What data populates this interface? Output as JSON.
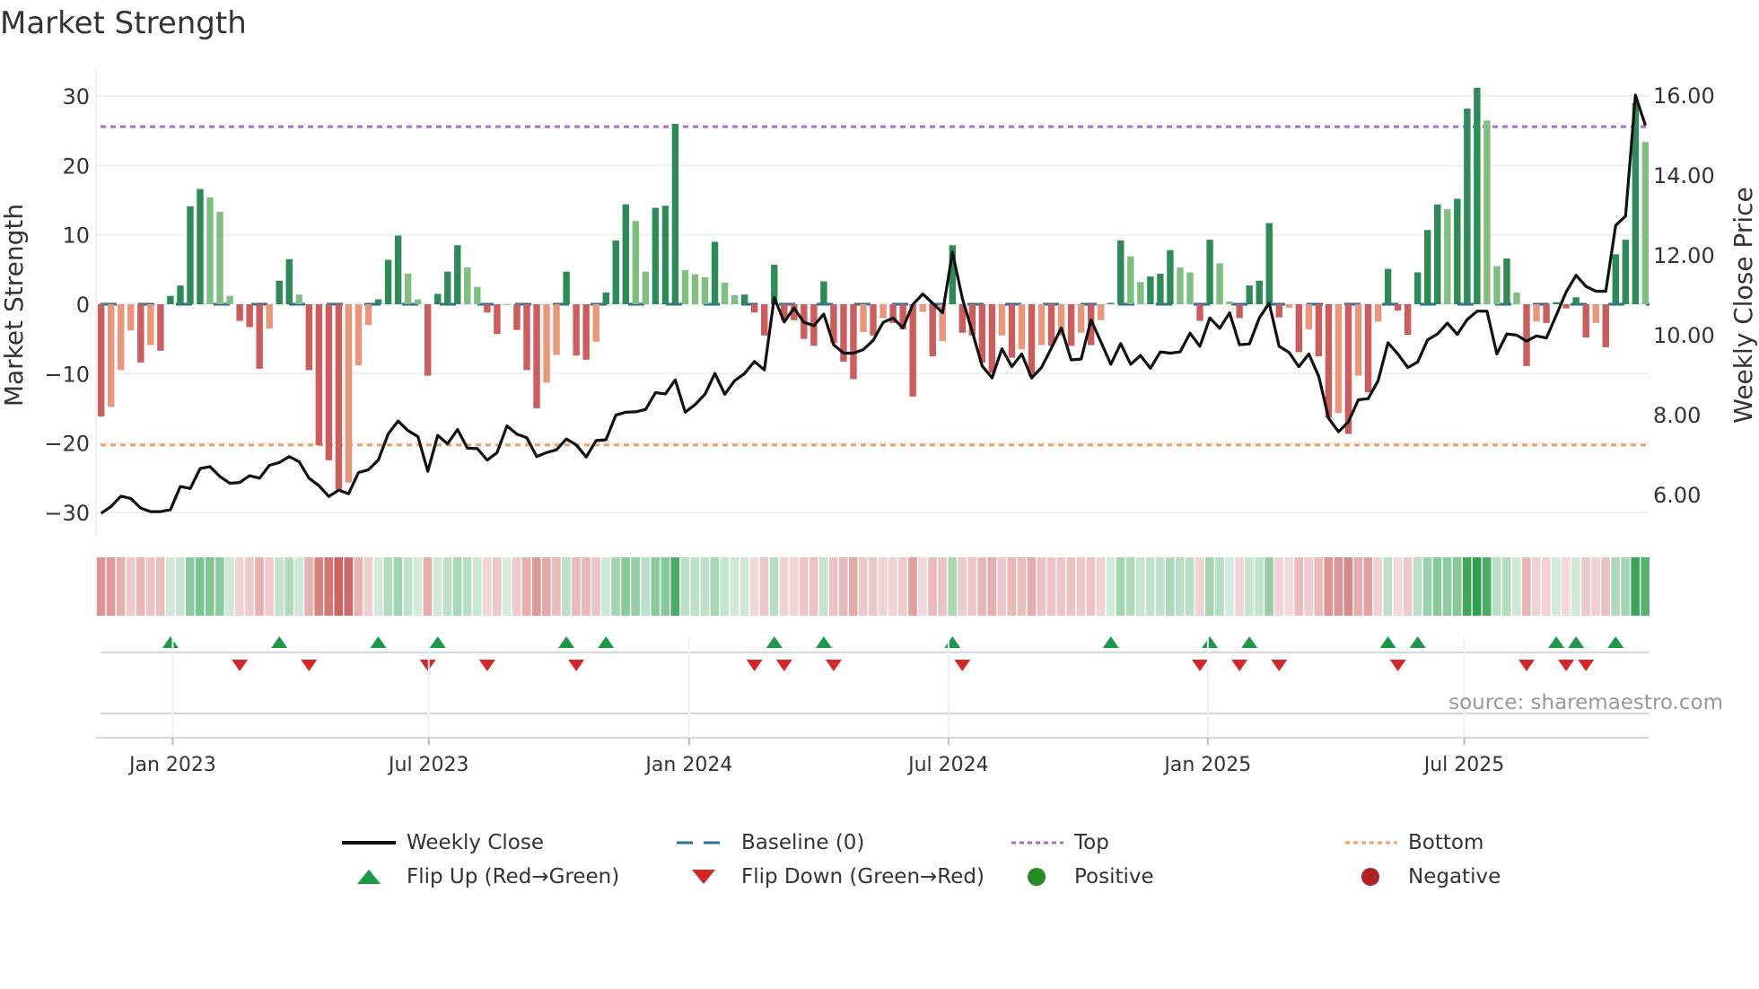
{
  "title": "Market Strength",
  "source": "source: sharemaestro.com",
  "colors": {
    "pos_strong": "#2e8b57",
    "pos_weak": "#7fbf7f",
    "neg_strong": "#cd5c5c",
    "neg_weak": "#e9967a",
    "line": "#111111",
    "baseline": "#2b6f9e",
    "top": "#a66be0",
    "bottom": "#f0a060",
    "flip_up": "#1a9a48",
    "flip_down": "#d62728",
    "positive": "#228b22",
    "negative": "#b22222"
  },
  "legend": [
    {
      "label": "Weekly Close",
      "icon": "line-icon"
    },
    {
      "label": "Baseline (0)",
      "icon": "dashed-line-icon"
    },
    {
      "label": "Top",
      "icon": "dotted-purple-line-icon"
    },
    {
      "label": "Bottom",
      "icon": "dotted-orange-line-icon"
    },
    {
      "label": "Flip Up (Red→Green)",
      "icon": "triangle-up-icon"
    },
    {
      "label": "Flip Down (Green→Red)",
      "icon": "triangle-down-icon"
    },
    {
      "label": "Positive",
      "icon": "green-dot-icon"
    },
    {
      "label": "Negative",
      "icon": "red-dot-icon"
    }
  ],
  "chart_data": {
    "type": "bar",
    "title": "Market Strength",
    "ylabel": "Market Strength",
    "y2label": "Weekly Close Price",
    "ylim": [
      -33,
      33
    ],
    "y2lim": [
      5.0,
      16.6
    ],
    "y_ticks": [
      "−30",
      "−20",
      "−10",
      "0",
      "10",
      "20",
      "30"
    ],
    "y_tick_values": [
      -30,
      -20,
      -10,
      0,
      10,
      20,
      30
    ],
    "y2_ticks": [
      "6.00",
      "8.00",
      "10.00",
      "12.00",
      "14.00",
      "16.00"
    ],
    "y2_tick_values": [
      6,
      8,
      10,
      12,
      14,
      16
    ],
    "x_ticks": [
      {
        "label": "Jan 2023",
        "week_index": 7.23
      },
      {
        "label": "Jul 2023",
        "week_index": 33.1
      },
      {
        "label": "Jan 2024",
        "week_index": 59.4
      },
      {
        "label": "Jul 2024",
        "week_index": 85.6
      },
      {
        "label": "Jan 2025",
        "week_index": 111.8
      },
      {
        "label": "Jul 2025",
        "week_index": 137.7
      }
    ],
    "top_level": 25.6,
    "bottom_level": -20.3,
    "baseline": 0,
    "grid": true,
    "legend_placement": "bottom",
    "strength": [
      -16.2,
      -14.8,
      -9.5,
      -3.8,
      -8.4,
      -5.9,
      -6.7,
      1.2,
      2.7,
      14.1,
      16.6,
      15.4,
      13.3,
      1.2,
      -2.4,
      -3.3,
      -9.3,
      -3.5,
      3.4,
      6.5,
      1.4,
      -9.5,
      -20.3,
      -22.5,
      -26.7,
      -25.7,
      -8.8,
      -3.0,
      0.7,
      6.4,
      9.9,
      4.4,
      0.7,
      -10.3,
      1.5,
      4.7,
      8.5,
      5.3,
      2.5,
      -1.2,
      -4.3,
      0,
      -3.7,
      -9.5,
      -15.0,
      -11.3,
      -7.3,
      4.7,
      -7.4,
      -8.0,
      -5.4,
      1.7,
      9.2,
      14.4,
      12.0,
      4.7,
      13.9,
      14.2,
      26.0,
      4.9,
      4.3,
      3.9,
      9.0,
      3.1,
      1.3,
      1.4,
      -1.2,
      -4.5,
      5.7,
      -2.3,
      -2.3,
      -5.0,
      -6.0,
      3.3,
      -5.6,
      -8.3,
      -10.8,
      -4.0,
      -4.5,
      -2.0,
      -2.7,
      -3.6,
      -13.3,
      -1.1,
      -7.5,
      -5.3,
      8.5,
      -4.1,
      -4.5,
      -8.4,
      -9.9,
      -4.5,
      -7.7,
      -6.5,
      -10.4,
      -5.9,
      -6.0,
      -4.5,
      -6.0,
      -4.1,
      -5.9,
      -2.3,
      0.2,
      9.2,
      6.9,
      3.2,
      4.0,
      4.4,
      7.8,
      5.3,
      4.6,
      -2.4,
      9.3,
      5.9,
      0.4,
      -2.0,
      2.7,
      3.4,
      11.7,
      -1.9,
      -0.5,
      -6.9,
      -3.6,
      -7.5,
      -16.4,
      -15.7,
      -18.7,
      -10.3,
      -12.7,
      -2.5,
      5.1,
      -0.9,
      -4.4,
      4.6,
      10.7,
      14.4,
      13.7,
      15.2,
      28.2,
      31.2,
      26.5,
      5.5,
      6.6,
      1.7,
      -8.9,
      -2.5,
      -2.7,
      0.3,
      -0.6,
      1.0,
      -4.8,
      -2.7,
      -6.2,
      7.2,
      9.3,
      29.0,
      23.4
    ],
    "weekly_close": [
      5.53,
      5.7,
      5.96,
      5.9,
      5.66,
      5.57,
      5.57,
      5.62,
      6.2,
      6.15,
      6.65,
      6.7,
      6.45,
      6.28,
      6.3,
      6.47,
      6.41,
      6.73,
      6.8,
      6.95,
      6.82,
      6.41,
      6.22,
      5.95,
      6.11,
      6.02,
      6.55,
      6.62,
      6.86,
      7.52,
      7.84,
      7.6,
      7.45,
      6.58,
      7.48,
      7.27,
      7.63,
      7.16,
      7.15,
      6.86,
      7.05,
      7.72,
      7.51,
      7.42,
      6.95,
      7.05,
      7.12,
      7.39,
      7.24,
      6.94,
      7.35,
      7.37,
      7.99,
      8.06,
      8.07,
      8.13,
      8.55,
      8.52,
      8.87,
      8.06,
      8.25,
      8.51,
      9.03,
      8.51,
      8.85,
      9.03,
      9.33,
      9.12,
      10.93,
      10.32,
      10.67,
      10.31,
      10.23,
      10.52,
      9.75,
      9.54,
      9.54,
      9.63,
      9.86,
      10.31,
      10.42,
      10.17,
      10.76,
      11.02,
      10.79,
      10.55,
      12.07,
      10.91,
      10.08,
      9.22,
      8.92,
      9.65,
      9.2,
      9.52,
      8.92,
      9.18,
      9.67,
      10.17,
      9.37,
      9.39,
      10.37,
      9.82,
      9.26,
      9.78,
      9.26,
      9.48,
      9.16,
      9.57,
      9.54,
      9.57,
      10.04,
      9.71,
      10.42,
      10.16,
      10.55,
      9.75,
      9.77,
      10.42,
      10.79,
      9.71,
      9.56,
      9.2,
      9.52,
      8.96,
      7.91,
      7.57,
      7.82,
      8.37,
      8.4,
      8.85,
      9.8,
      9.52,
      9.18,
      9.32,
      9.87,
      10.02,
      10.29,
      10.01,
      10.38,
      10.59,
      10.59,
      9.52,
      10.02,
      9.99,
      9.84,
      9.97,
      9.92,
      10.49,
      11.07,
      11.49,
      11.21,
      11.09,
      11.09,
      12.74,
      12.97,
      16.0,
      15.24
    ]
  }
}
